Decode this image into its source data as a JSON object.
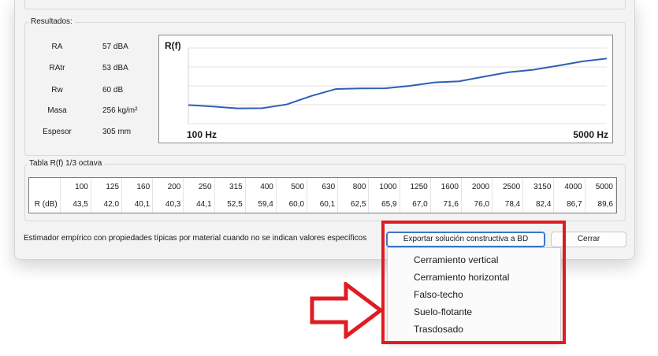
{
  "results": {
    "title": "Resultados:",
    "items": [
      {
        "label": "RA",
        "value": "57 dBA"
      },
      {
        "label": "RAtr",
        "value": "53 dBA"
      },
      {
        "label": "Rw",
        "value": "60 dB"
      },
      {
        "label": "Masa",
        "value": "256 kg/m²"
      },
      {
        "label": "Espesor",
        "value": "305 mm"
      }
    ]
  },
  "plot": {
    "y_label": "R(f)",
    "x_start_label": "100 Hz",
    "x_end_label": "5000 Hz",
    "line_color": "#2f5fb5"
  },
  "chart_data": {
    "type": "line",
    "x": [
      "100",
      "125",
      "160",
      "200",
      "250",
      "315",
      "400",
      "500",
      "630",
      "800",
      "1000",
      "1250",
      "1600",
      "2000",
      "2500",
      "3150",
      "4000",
      "5000"
    ],
    "series": [
      {
        "values": [
          43.5,
          42.0,
          40.1,
          40.3,
          44.1,
          52.5,
          59.4,
          60.0,
          60.1,
          62.5,
          65.9,
          67.0,
          71.6,
          76.0,
          78.4,
          82.4,
          86.7,
          89.6
        ]
      }
    ]
  },
  "table": {
    "title": "Tabla R(f) 1/3 octava",
    "row_label": "R (dB)",
    "frequencies": [
      "100",
      "125",
      "160",
      "200",
      "250",
      "315",
      "400",
      "500",
      "630",
      "800",
      "1000",
      "1250",
      "1600",
      "2000",
      "2500",
      "3150",
      "4000",
      "5000"
    ],
    "values": [
      "43,5",
      "42,0",
      "40,1",
      "40,3",
      "44,1",
      "52,5",
      "59,4",
      "60,0",
      "60,1",
      "62,5",
      "65,9",
      "67,0",
      "71,6",
      "76,0",
      "78,4",
      "82,4",
      "86,7",
      "89,6"
    ]
  },
  "footer": {
    "note": "Estimador empírico con propiedades típicas por material cuando no se indican valores específicos",
    "export_label": "Exportar solución constructiva a BD",
    "close_label": "Cerrar"
  },
  "menu": {
    "items": [
      "Cerramiento vertical",
      "Cerramiento horizontal",
      "Falso-techo",
      "Suelo-flotante",
      "Trasdosado"
    ]
  },
  "annotation": {
    "highlight_color": "#e11b22"
  }
}
